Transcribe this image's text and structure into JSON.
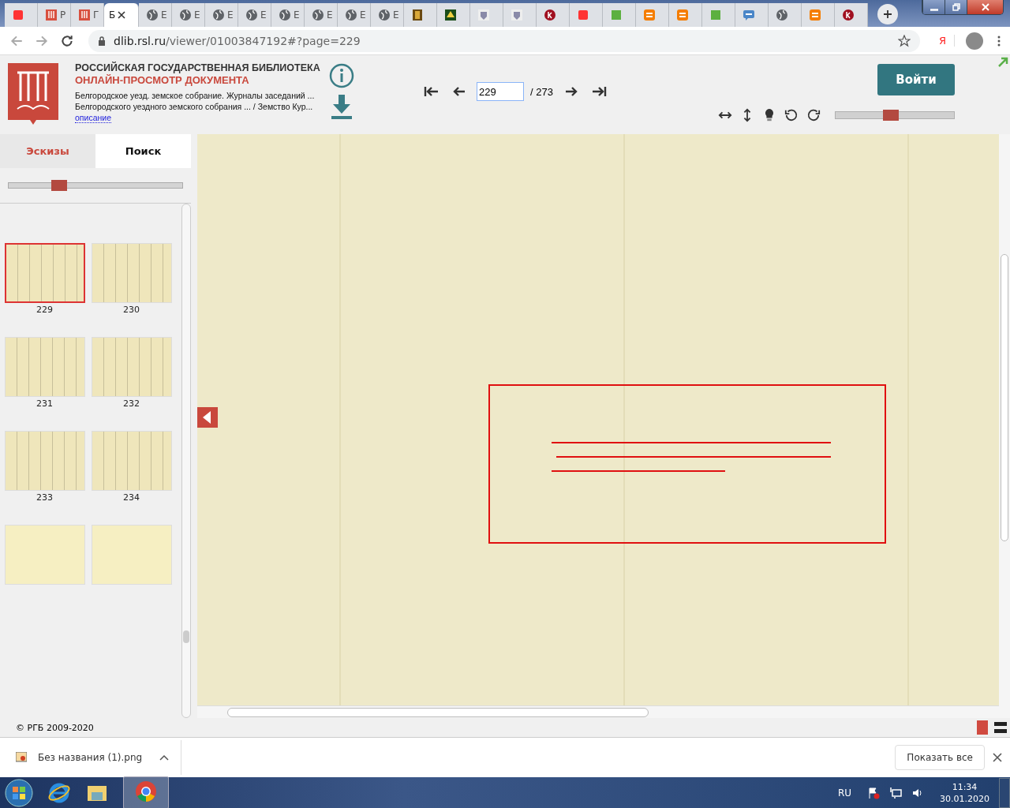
{
  "browser": {
    "tabs": [
      {
        "kind": "yandex",
        "selected": false
      },
      {
        "kind": "library",
        "title": "Р",
        "selected": false
      },
      {
        "kind": "library",
        "title": "Г",
        "selected": false
      },
      {
        "kind": "plain",
        "title": "Б",
        "selected": true
      },
      {
        "kind": "globe",
        "title": "Е",
        "selected": false
      },
      {
        "kind": "globe",
        "title": "Е",
        "selected": false
      },
      {
        "kind": "globe",
        "title": "Е",
        "selected": false
      },
      {
        "kind": "globe",
        "title": "Е",
        "selected": false
      },
      {
        "kind": "globe",
        "title": "Е",
        "selected": false
      },
      {
        "kind": "globe",
        "title": "Е",
        "selected": false
      },
      {
        "kind": "globe",
        "title": "Е",
        "selected": false
      },
      {
        "kind": "globe",
        "title": "Е",
        "selected": false
      },
      {
        "kind": "book",
        "selected": false
      },
      {
        "kind": "tree",
        "selected": false
      },
      {
        "kind": "crest",
        "selected": false
      },
      {
        "kind": "crest",
        "selected": false
      },
      {
        "kind": "k",
        "selected": false
      },
      {
        "kind": "yandex",
        "selected": false
      },
      {
        "kind": "green",
        "selected": false
      },
      {
        "kind": "blogger",
        "selected": false
      },
      {
        "kind": "blogger",
        "selected": false
      },
      {
        "kind": "green",
        "selected": false
      },
      {
        "kind": "chat",
        "selected": false
      },
      {
        "kind": "globe",
        "selected": false
      },
      {
        "kind": "blogger",
        "selected": false
      },
      {
        "kind": "k",
        "selected": false
      }
    ],
    "address": {
      "host": "dlib.rsl.ru",
      "path": "/viewer/01003847192#?page=229"
    },
    "extension_label": "Я"
  },
  "header": {
    "org": "РОССИЙСКАЯ ГОСУДАРСТВЕННАЯ БИБЛИОТЕКА",
    "subtitle": "ОНЛАЙН-ПРОСМОТР ДОКУМЕНТА",
    "description": "Белгородское уезд. земское собрание. Журналы заседаний ... Белгородского уездного земского собрания ... / Земство Кур...",
    "description_link": "описание",
    "page": "229",
    "total": "/ 273",
    "login": "Войти",
    "zoom": {
      "level": 0.47
    }
  },
  "sidebar": {
    "tabs": [
      {
        "label": "Эскизы",
        "selected": true
      },
      {
        "label": "Поиск",
        "selected": false
      }
    ],
    "size": {
      "level": 0.29
    },
    "thumbnails": [
      {
        "label": "229",
        "selected": true
      },
      {
        "label": "230",
        "selected": false
      },
      {
        "label": "231",
        "selected": false
      },
      {
        "label": "232",
        "selected": false
      },
      {
        "label": "233",
        "selected": false
      },
      {
        "label": "234",
        "selected": false
      },
      {
        "selected": false
      },
      {
        "selected": false
      }
    ]
  },
  "footer": {
    "copyright": "© РГБ 2009-2020"
  },
  "downloads": {
    "file": "Без названия (1).png",
    "show_all": "Показать все"
  },
  "taskbar": {
    "language": "RU",
    "time": "11:34",
    "date": "30.01.2020"
  }
}
